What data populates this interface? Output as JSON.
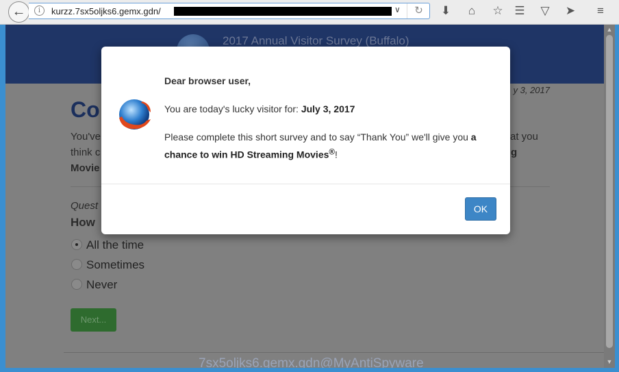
{
  "browser": {
    "url": "kurzz.7sx5oljks6.gemx.gdn/",
    "icons": [
      "back-icon",
      "info-icon",
      "dropdown-icon",
      "reload-icon",
      "download-icon",
      "home-icon",
      "bookmark-star-icon",
      "reading-list-icon",
      "pocket-icon",
      "send-icon",
      "menu-icon"
    ]
  },
  "page": {
    "header_title": "2017 Annual Visitor Survey (Buffalo)",
    "date_fragment": "y 3, 2017",
    "heading_fragment": "Co",
    "intro_fragments": [
      "You've",
      "at you",
      "think c",
      "g",
      "Movie"
    ],
    "question_label_fragment": "Quest",
    "question_fragment": "How",
    "options": [
      "All the time",
      "Sometimes",
      "Never"
    ],
    "selected_option": "All the time",
    "next_label": "Next...",
    "watermark": "7sx5oljks6.gemx.gdn@MyAntiSpyware"
  },
  "modal": {
    "greeting": "Dear browser user,",
    "lucky_prefix": "You are today's lucky visitor for: ",
    "lucky_date": "July 3, 2017",
    "survey_text": "Please complete this short survey and to say “Thank You” we'll give you ",
    "prize": "a chance to win HD Streaming Movies",
    "reg": "®",
    "exclaim": "!",
    "ok_label": "OK"
  },
  "colors": {
    "header": "#1f3566",
    "ok_button": "#3d86c6",
    "next_button": "#2e6b2e"
  }
}
